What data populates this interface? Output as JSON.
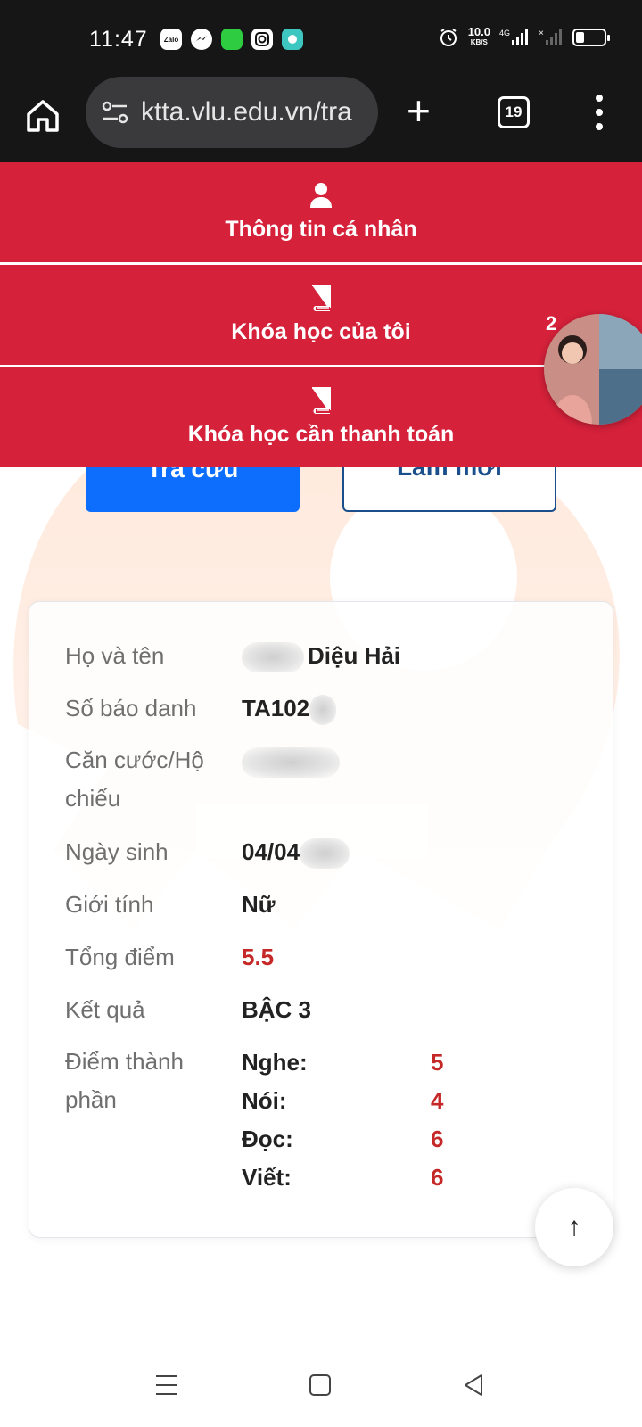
{
  "status_bar": {
    "time": "11:47",
    "net_speed_value": "10.0",
    "net_speed_unit": "KB/S",
    "network_type": "4G",
    "battery_percent": 25,
    "app_icons": [
      "zalo-icon",
      "messenger-icon",
      "app-icon",
      "instagram-icon",
      "chat-app-icon"
    ]
  },
  "browser": {
    "url": "ktta.vlu.edu.vn/tra",
    "tab_count": "19"
  },
  "nav_menu": {
    "items": [
      {
        "label": "Thông tin cá nhân",
        "icon": "user-icon"
      },
      {
        "label": "Khóa học của tôi",
        "icon": "book-icon"
      },
      {
        "label": "Khóa học cần thanh toán",
        "icon": "book-icon"
      }
    ]
  },
  "chat_head": {
    "badge": "2"
  },
  "actions": {
    "search_label": "Tra cứu",
    "reset_label": "Làm mới"
  },
  "result": {
    "name_label": "Họ và tên",
    "name_value": "Diệu Hải",
    "sbd_label": "Số báo danh",
    "sbd_value": "TA102",
    "id_label_1": "Căn cước/Hộ",
    "id_label_2": "chiếu",
    "dob_label": "Ngày sinh",
    "dob_value": "04/04",
    "gender_label": "Giới tính",
    "gender_value": "Nữ",
    "total_label": "Tổng điểm",
    "total_value": "5.5",
    "result_label": "Kết quả",
    "result_value": "BẬC 3",
    "components_label_1": "Điểm thành",
    "components_label_2": "phần",
    "components": [
      {
        "name": "Nghe:",
        "score": "5"
      },
      {
        "name": "Nói:",
        "score": "4"
      },
      {
        "name": "Đọc:",
        "score": "6"
      },
      {
        "name": "Viết:",
        "score": "6"
      }
    ]
  },
  "scroll_top": {
    "icon": "arrow-up-icon",
    "glyph": "↑"
  },
  "colors": {
    "nav_red": "#d5213a",
    "primary_blue": "#0d6efd",
    "score_red": "#c62828",
    "chrome_dark": "#161616"
  }
}
